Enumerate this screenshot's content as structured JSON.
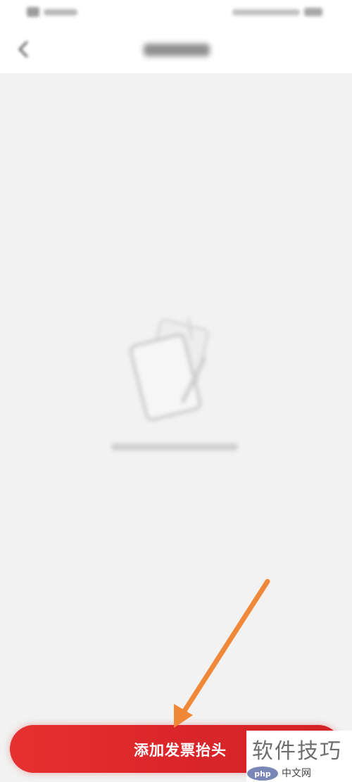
{
  "bottom_bar": {
    "add_button_label": "添加发票抬头"
  },
  "icons": {
    "back": "chevron-left-icon",
    "empty": "empty-document-icon",
    "annotation": "orange-arrow-icon"
  },
  "colors": {
    "primary": "#dc2a2b",
    "background": "#f2f2f2",
    "annotation": "#f0883a"
  },
  "watermark": {
    "title": "软件技巧",
    "logo_text": "php",
    "site": "中文网"
  }
}
